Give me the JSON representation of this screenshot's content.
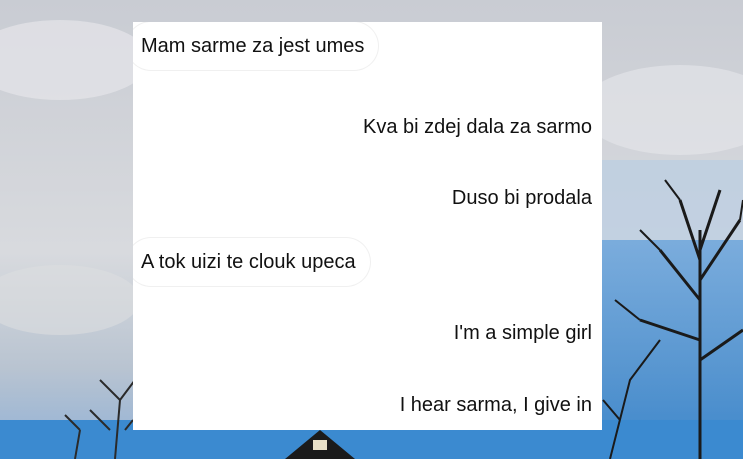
{
  "messages": [
    {
      "side": "received",
      "text": "Mam sarme za jest umes"
    },
    {
      "side": "sent",
      "text": "Kva bi zdej dala za sarmo"
    },
    {
      "side": "sent",
      "text": "Duso bi prodala"
    },
    {
      "side": "received",
      "text": "A tok uizi te clouk upeca"
    },
    {
      "side": "sent",
      "text": "I'm a simple girl"
    },
    {
      "side": "sent",
      "text": "I hear sarma, I give in"
    }
  ],
  "colors": {
    "sky": "#cfd3da",
    "blue_sky": "#2f7fc8",
    "card": "#ffffff",
    "text": "#111111"
  },
  "background": {
    "description_icon": "tree-silhouette-icon"
  }
}
